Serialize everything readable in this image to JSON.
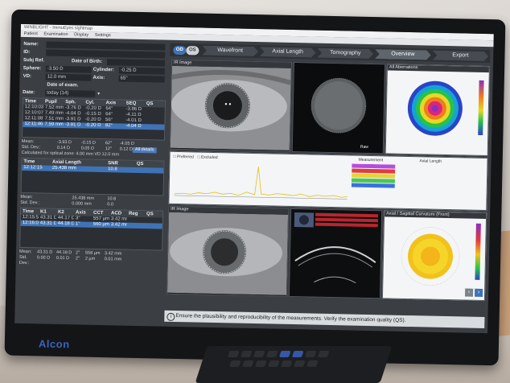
{
  "window": {
    "title": "WINBLIGHT - ImmuEyes sightmap",
    "menu": [
      "Patient",
      "Examination",
      "Display",
      "Settings"
    ]
  },
  "patient": {
    "name_label": "Name:",
    "id_label": "ID:",
    "subj_ref_label": "Subj Ref.",
    "dob_label": "Date of Birth:",
    "sphere_label": "Sphere:",
    "sphere_value": "-3.50 D",
    "cylinder_label": "Cylinder:",
    "cylinder_value": "-0.25 D",
    "vd_label": "VD:",
    "vd_value": "12.0 mm",
    "axis_label": "Axis:",
    "axis_value": "65°",
    "date_exam_label": "Date of exam.",
    "date_label": "Date:",
    "date_value": "today (14)"
  },
  "refraction_table": {
    "headers": [
      "Time",
      "Pupil",
      "Sph.",
      "Cyl.",
      "Axis",
      "SEQ",
      "QS"
    ],
    "rows": [
      [
        "12:10:03",
        "7.52 mm",
        "-3.76 D",
        "-0.20 D",
        "64°",
        "-3.86 D",
        ""
      ],
      [
        "12:10:07",
        "7.49 mm",
        "-4.04 D",
        "-0.15 D",
        "64°",
        "-4.11 D",
        ""
      ],
      [
        "12:11:08",
        "7.51 mm",
        "-3.91 D",
        "-0.20 D",
        "56°",
        "-4.01 D",
        ""
      ],
      [
        "12:11:46",
        "7.59 mm",
        "-3.91 D",
        "-0.20 D",
        "82°",
        "-4.04 D",
        ""
      ]
    ],
    "selected_row": 3,
    "mean_label": "Mean:",
    "mean": [
      "-3.93 D",
      "-0.15 D",
      "62°",
      "-4.05 D"
    ],
    "std_label": "Std. Dev.:",
    "std": [
      "0.14 D",
      "0.05 D",
      "12°",
      "0.12 D"
    ],
    "calc_label": "Calculated for optical zone:",
    "calc_value": "4.00 mm",
    "vd_label": "VD 12.0 mm",
    "details_button": "All details"
  },
  "axial_table": {
    "headers": [
      "Time",
      "Axial Length",
      "SNR",
      "QS"
    ],
    "rows": [
      [
        "12:12:15",
        "25.438 mm",
        "10.8",
        ""
      ]
    ],
    "mean_label": "Mean:",
    "mean": [
      "25.438 mm",
      "10.8"
    ],
    "std_label": "Std. Dev.:",
    "std": [
      "0.000 mm",
      "0.0"
    ]
  },
  "kerato_table": {
    "headers": [
      "Time",
      "K1",
      "K2",
      "Axis",
      "CCT",
      "ACD",
      "Reg",
      "QS"
    ],
    "rows": [
      [
        "12:15:59",
        "43.31 D",
        "44.17 D",
        "3°",
        "557 µm",
        "3.42 mm",
        "",
        ""
      ],
      [
        "12:16:03",
        "43.31 D",
        "44.18 D",
        "1°",
        "560 µm",
        "3.42 mm",
        "",
        ""
      ]
    ],
    "mean_label": "Mean:",
    "mean": [
      "43.31 D",
      "44.18 D",
      "2°",
      "558 µm",
      "3.42 mm"
    ],
    "std_label": "Std. Dev.:",
    "std": [
      "0.00 D",
      "0.01 D",
      "2°",
      "2 µm",
      "0.01 mm"
    ]
  },
  "tabs": {
    "od": "OD",
    "os": "OS",
    "items": [
      "Wavefront",
      "Axial Length",
      "Tomography",
      "Overview",
      "Export"
    ],
    "active": 3
  },
  "panels": {
    "ir_image_top": "IR Image",
    "aberrations": "All Aberrations",
    "preferred": "Preferred",
    "excluded": "Excluded",
    "measurement": "Measurement",
    "axial_length": "Axial Length",
    "ir_image_bottom": "IR Image",
    "curvature": "Axial / Sagittal Curvature (Front)",
    "raw": "Raw"
  },
  "footer": {
    "message": "Ensure the plausibility and reproducibility of the measurements. Verify the examination quality (QS)."
  },
  "brand": {
    "name": "Alcon"
  },
  "colors": {
    "od": "#3f73b5",
    "os": "#cfd3d8",
    "selection": "#3f73b5"
  }
}
